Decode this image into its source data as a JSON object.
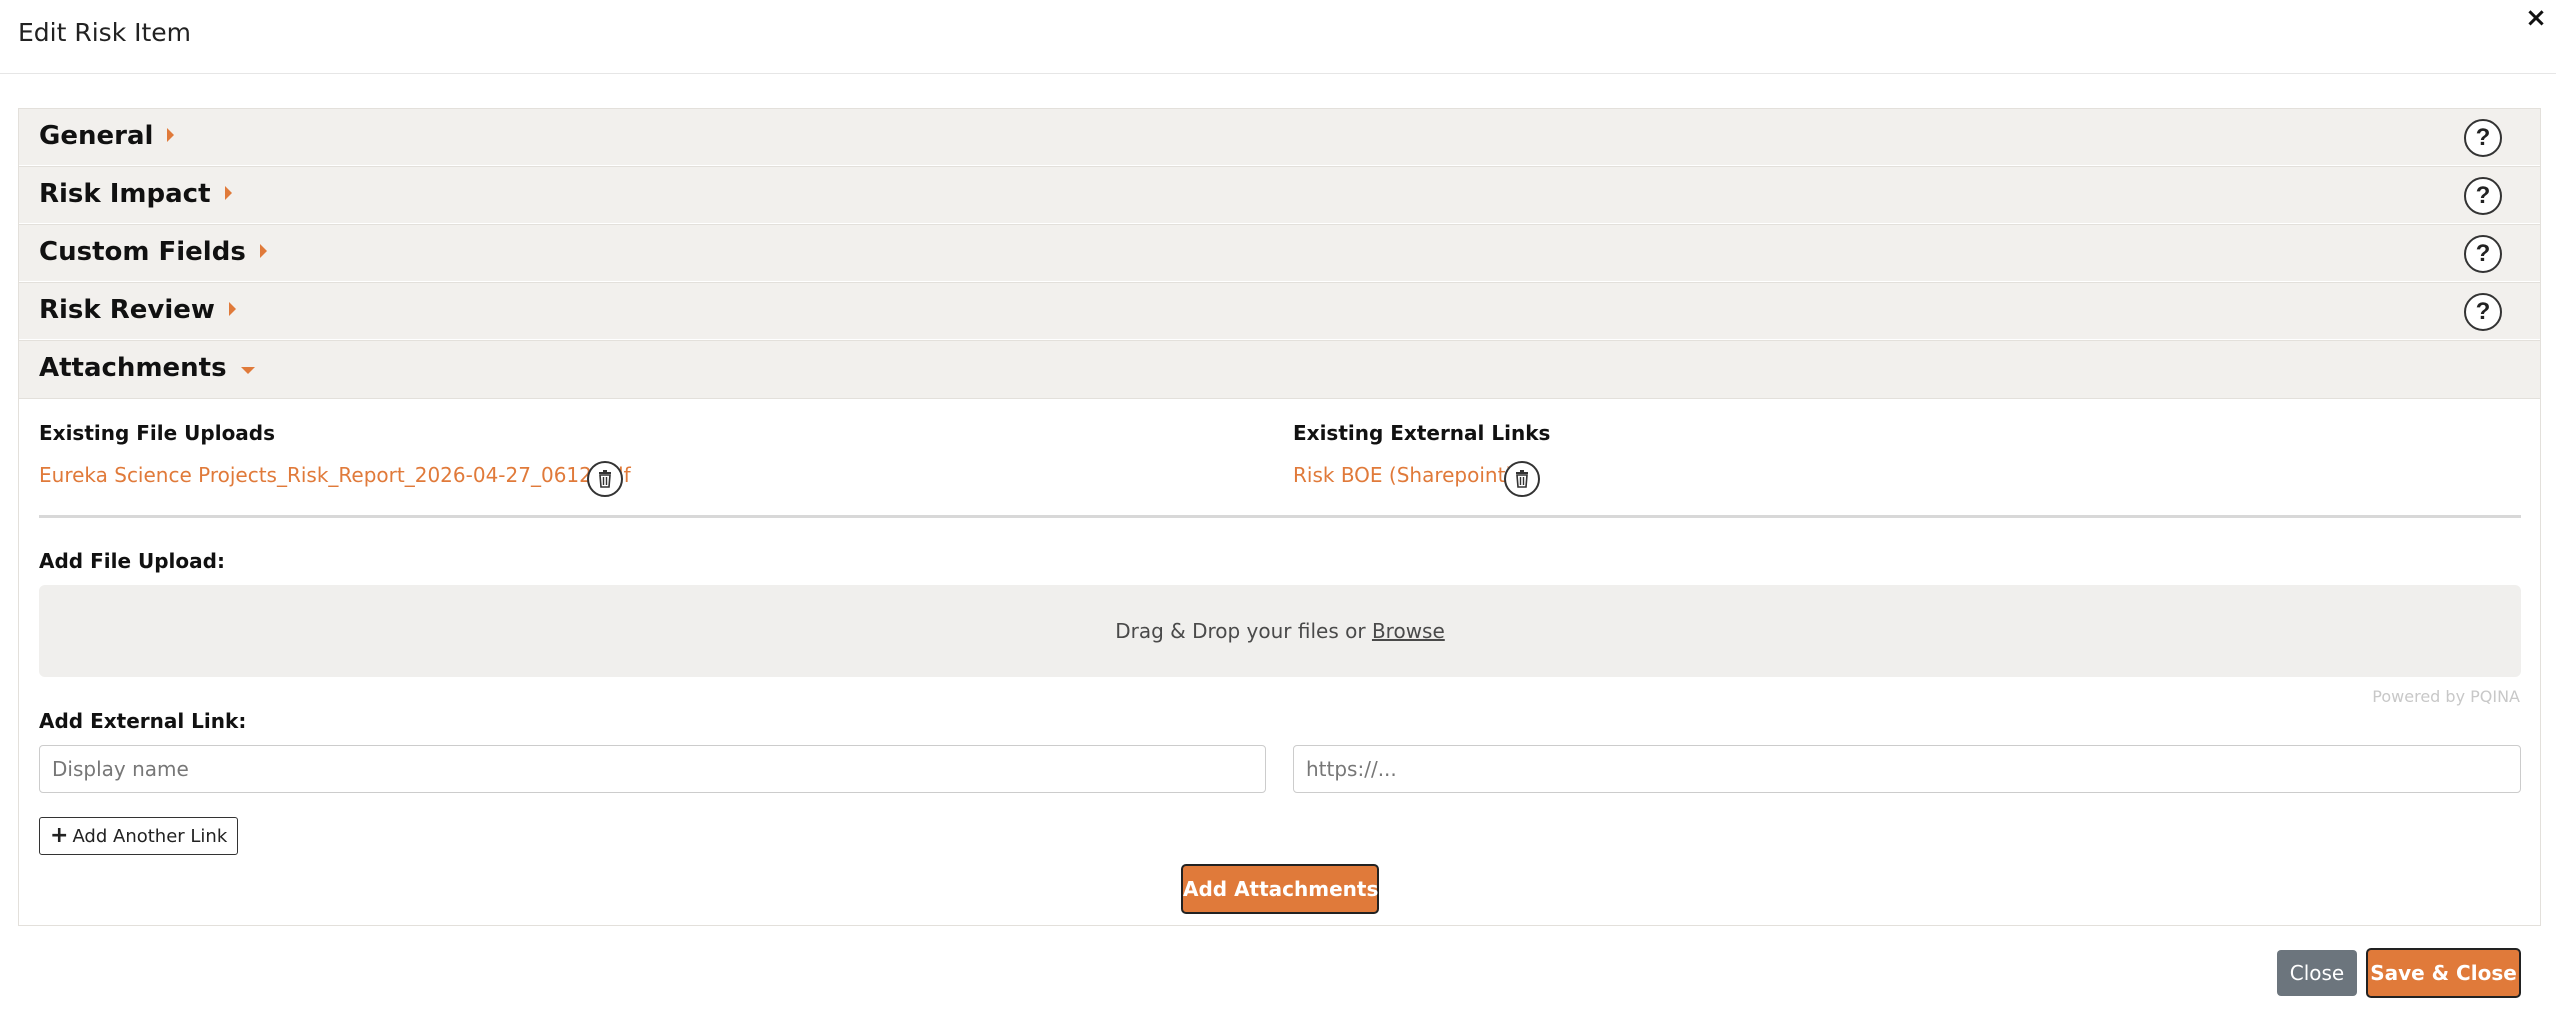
{
  "modal": {
    "title": "Edit Risk Item",
    "close_symbol": "×"
  },
  "accordion": {
    "sections": [
      {
        "label": "General",
        "expanded": false,
        "help": "?"
      },
      {
        "label": "Risk Impact",
        "expanded": false,
        "help": "?"
      },
      {
        "label": "Custom Fields",
        "expanded": false,
        "help": "?"
      },
      {
        "label": "Risk Review",
        "expanded": false,
        "help": "?"
      },
      {
        "label": "Attachments",
        "expanded": true
      }
    ],
    "caret_color": "#e07a3a"
  },
  "attachments": {
    "existing_uploads_label": "Existing File Uploads",
    "existing_links_label": "Existing External Links",
    "uploads": [
      {
        "name": "Eureka Science Projects_Risk_Report_2026-04-27_0612.pdf",
        "delete_icon": "trash-icon"
      }
    ],
    "links": [
      {
        "name": "Risk BOE (Sharepoint)",
        "delete_icon": "trash-icon"
      }
    ],
    "add_file_label": "Add File Upload:",
    "dropzone_text": "Drag & Drop your files or ",
    "dropzone_browse": "Browse",
    "powered_by": "Powered by PQINA",
    "add_link_label": "Add External Link:",
    "display_name_placeholder": "Display name",
    "url_placeholder": "https://...",
    "add_another_link": "Add Another Link",
    "add_attachments": "Add Attachments"
  },
  "footer": {
    "close_label": "Close",
    "save_close_label": "Save & Close"
  },
  "colors": {
    "accent": "#e07a3a",
    "header_bg": "#f2f0ed",
    "secondary_button": "#6c757d"
  }
}
